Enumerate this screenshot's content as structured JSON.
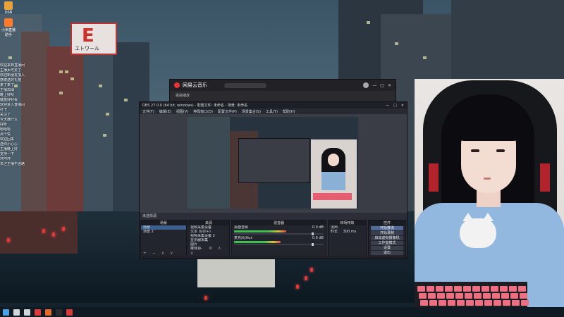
{
  "wallpaper": {
    "sign_char": "E",
    "sign_text": "エトワール"
  },
  "desktop_icons": [
    {
      "label": "DSB",
      "color": "#e8a23a"
    },
    {
      "label": "小米直播助手",
      "color": "#ff7a2a"
    }
  ],
  "chat": [
    {
      "name": "",
      "msg": "欢迎来到直播间"
    },
    {
      "name": "",
      "msg": "主播太可爱了"
    },
    {
      "name": "",
      "msg": "欢迎新朋友加入"
    },
    {
      "name": "",
      "msg": "感谢送的礼物"
    },
    {
      "name": "",
      "msg": "来了来了"
    },
    {
      "name": "",
      "msg": "主播加油"
    },
    {
      "name": "",
      "msg": "晚上好呀"
    },
    {
      "name": "",
      "msg": "键盘好好看"
    },
    {
      "name": "",
      "msg": "欢迎进入直播间"
    },
    {
      "name": "",
      "msg": "打卡"
    },
    {
      "name": "",
      "msg": "关注了"
    },
    {
      "name": "",
      "msg": "今天播什么"
    },
    {
      "name": "",
      "msg": "好听"
    },
    {
      "name": "",
      "msg": "哈哈哈"
    },
    {
      "name": "",
      "msg": "点个赞"
    },
    {
      "name": "",
      "msg": "欢迎回来"
    },
    {
      "name": "",
      "msg": "送你小心心"
    },
    {
      "name": "",
      "msg": "主播晚上好"
    },
    {
      "name": "",
      "msg": "支持一下"
    },
    {
      "name": "",
      "msg": "冲冲冲"
    },
    {
      "name": "",
      "msg": "关注主播不迷路"
    }
  ],
  "music_app": {
    "title": "网易云音乐",
    "subtitle": "歌曲播放",
    "controls": [
      "—",
      "□",
      "✕"
    ]
  },
  "obs": {
    "title": "OBS 27.0.0 (64 bit, windows) - 配置文件: 未命名 - 场景: 未命名",
    "menu": [
      "文件(F)",
      "编辑(E)",
      "视图(V)",
      "停靠窗口(D)",
      "配置文件(P)",
      "场景集合(S)",
      "工具(T)",
      "帮助(H)"
    ],
    "midbar_text": "未选择源",
    "docks": {
      "scenes": {
        "title": "场景",
        "items": [
          "场景",
          "场景 2"
        ],
        "selected": 0
      },
      "sources": {
        "title": "来源",
        "items": [
          "视频采集设备",
          "文本 (GDI+)",
          "视频采集设备 2",
          "显示器采集",
          "图片",
          "媒体源"
        ],
        "selected": -1
      },
      "mixer": {
        "title": "混音器",
        "channels": [
          {
            "label": "桌面音频",
            "value": "0.0 dB",
            "level": 0.62
          },
          {
            "label": "麦克风/Aux",
            "value": "0.0 dB",
            "level": 0.55
          }
        ]
      },
      "transitions": {
        "title": "转场特效",
        "type": "淡出",
        "duration_label": "时长",
        "duration": "300 ms"
      },
      "controls": {
        "title": "控件",
        "buttons": [
          "开始推流",
          "开始录制",
          "启动虚拟摄像机",
          "工作室模式",
          "设置",
          "退出"
        ]
      }
    }
  },
  "taskbar": {
    "icons": [
      {
        "name": "windows-start-icon",
        "color": "#4aa3e8"
      },
      {
        "name": "search-icon",
        "color": "#cfd6dc"
      },
      {
        "name": "task-view-icon",
        "color": "#cfd6dc"
      },
      {
        "name": "netease-music-icon",
        "color": "#e23a3a"
      },
      {
        "name": "browser-icon",
        "color": "#e86a2a"
      },
      {
        "name": "obs-icon",
        "color": "#2c2c30"
      },
      {
        "name": "app-icon",
        "color": "#d83a3a"
      }
    ]
  }
}
